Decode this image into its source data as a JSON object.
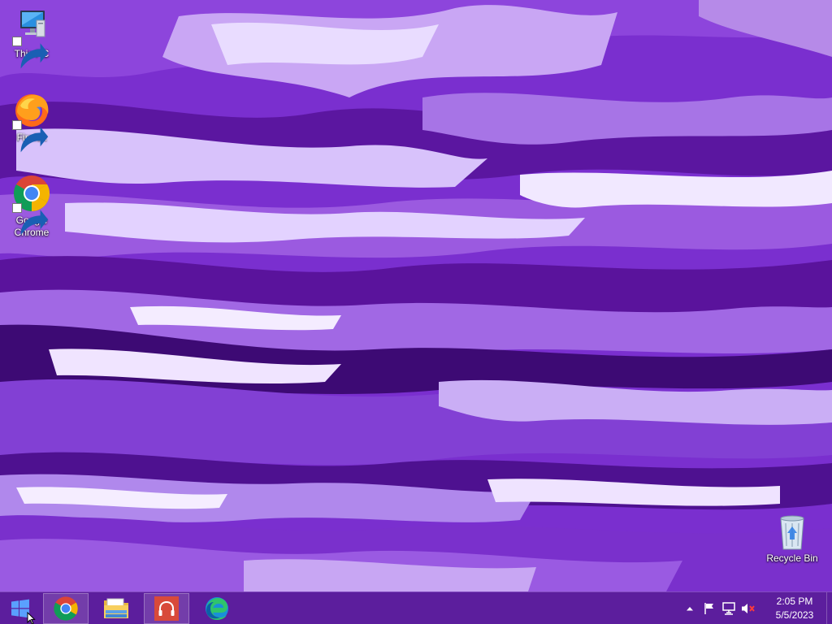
{
  "desktop": {
    "icons": [
      {
        "label": "This PC",
        "icon": "computer-icon"
      },
      {
        "label": "Firefox",
        "icon": "firefox-icon"
      },
      {
        "label": "Google Chrome",
        "icon": "chrome-icon"
      },
      {
        "label": "Recycle Bin",
        "icon": "recycle-bin-icon"
      }
    ]
  },
  "taskbar": {
    "start_icon": "windows-logo-icon",
    "pinned": [
      {
        "name": "Google Chrome",
        "icon": "chrome-icon",
        "active": true
      },
      {
        "name": "File Explorer",
        "icon": "folder-icon",
        "active": false
      },
      {
        "name": "Music player",
        "icon": "headphones-icon",
        "active": true
      },
      {
        "name": "Microsoft Edge",
        "icon": "edge-icon",
        "active": false
      }
    ],
    "tray": {
      "icons": [
        "chevron-up-icon",
        "flag-icon",
        "network-icon",
        "volume-muted-icon"
      ],
      "time": "2:05 PM",
      "date": "5/5/2023"
    }
  },
  "colors": {
    "wallpaper_primary": "#7b2fd0",
    "wallpaper_dark": "#4a0d86",
    "wallpaper_light": "#e8d8ff",
    "taskbar": "#581c96"
  }
}
